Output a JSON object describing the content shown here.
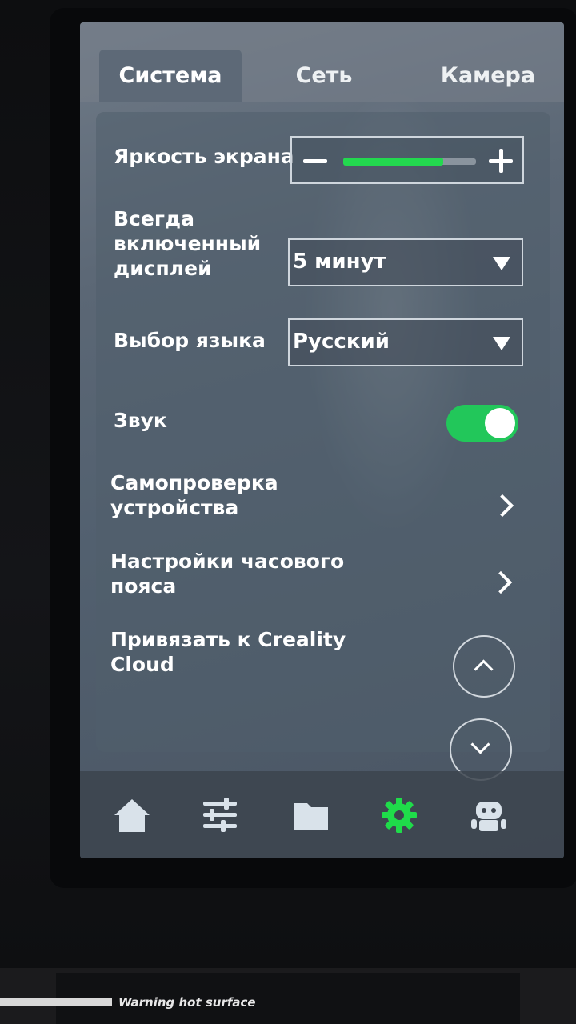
{
  "tabs": [
    {
      "label": "Система",
      "active": true
    },
    {
      "label": "Сеть",
      "active": false
    },
    {
      "label": "Камера",
      "active": false
    }
  ],
  "settings": {
    "brightness": {
      "label": "Яркость экрана",
      "level": 0.75
    },
    "always_on": {
      "label_lines": [
        "Всегда",
        "включенный",
        "дисплей"
      ],
      "value": "5 минут"
    },
    "language": {
      "label": "Выбор языка",
      "value": "Русский"
    },
    "sound": {
      "label": "Звук",
      "enabled": true
    },
    "self_check": {
      "label_lines": [
        "Самопроверка",
        "устройства"
      ]
    },
    "timezone": {
      "label_lines": [
        "Настройки часового",
        "пояса"
      ]
    },
    "creality_cloud": {
      "label_lines": [
        "Привязать к Creality",
        "Cloud"
      ]
    }
  },
  "nav": [
    {
      "icon": "home-icon",
      "active": false
    },
    {
      "icon": "sliders-icon",
      "active": false
    },
    {
      "icon": "folder-icon",
      "active": false
    },
    {
      "icon": "gear-icon",
      "active": true
    },
    {
      "icon": "robot-icon",
      "active": false
    }
  ],
  "colors": {
    "accent": "#22c75a",
    "active_icon": "#1fdc4a",
    "icon": "#d9e2ea"
  },
  "device_label": "Warning hot surface"
}
